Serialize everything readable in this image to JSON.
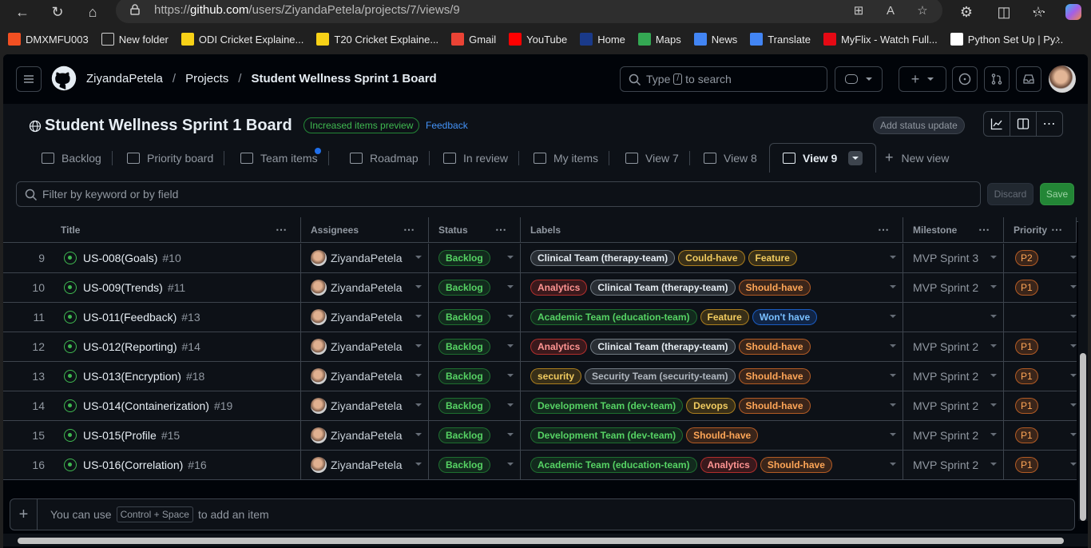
{
  "browser": {
    "url_prefix": "https://",
    "url_host": "github.com",
    "url_path": "/users/ZiyandaPetela/projects/7/views/9",
    "bookmarks": [
      {
        "label": "DMXMFU003",
        "icon": "windows-icon",
        "color": "#f25022"
      },
      {
        "label": "New folder",
        "icon": "folder-icon",
        "color": "#d0d0d0"
      },
      {
        "label": "ODI Cricket Explaine...",
        "icon": "bc-icon",
        "color": "#f7d117"
      },
      {
        "label": "T20 Cricket Explaine...",
        "icon": "bc-icon",
        "color": "#f7d117"
      },
      {
        "label": "Gmail",
        "icon": "gmail-icon",
        "color": "#ea4335"
      },
      {
        "label": "YouTube",
        "icon": "youtube-icon",
        "color": "#ff0000"
      },
      {
        "label": "Home",
        "icon": "v-icon",
        "color": "#1a3a8a"
      },
      {
        "label": "Maps",
        "icon": "maps-icon",
        "color": "#34a853"
      },
      {
        "label": "News",
        "icon": "news-icon",
        "color": "#4285f4"
      },
      {
        "label": "Translate",
        "icon": "translate-icon",
        "color": "#4285f4"
      },
      {
        "label": "MyFlix - Watch Full...",
        "icon": "m-icon",
        "color": "#e50914"
      },
      {
        "label": "Python Set Up | Py...",
        "icon": "python-icon",
        "color": "#ffffff"
      }
    ]
  },
  "header": {
    "user": "ZiyandaPetela",
    "section": "Projects",
    "board": "Student Wellness Sprint 1 Board",
    "search_prefix": "Type",
    "search_key": "/",
    "search_suffix": "to search"
  },
  "project": {
    "title": "Student Wellness Sprint 1 Board",
    "preview_badge": "Increased items preview",
    "feedback": "Feedback",
    "status_update": "Add status update"
  },
  "tabs": [
    "Backlog",
    "Priority board",
    "Team items",
    "Roadmap",
    "In review",
    "My items",
    "View 7",
    "View 8",
    "View 9"
  ],
  "new_view": "New view",
  "filter": {
    "placeholder": "Filter by keyword or by field",
    "discard": "Discard",
    "save": "Save"
  },
  "columns": [
    "Title",
    "Assignees",
    "Status",
    "Labels",
    "Milestone",
    "Priority"
  ],
  "colors": {
    "label_clinical": "#8b949e",
    "label_couldhave": "#d29922",
    "label_feature": "#d29922",
    "label_analytics": "#da3633",
    "label_shouldhave": "#db6d28",
    "label_academic": "#238636",
    "label_wonthave": "#1f6feb",
    "label_security": "#d29922",
    "label_securityteam": "#8b949e",
    "label_dev": "#238636",
    "label_devops": "#d29922",
    "status_backlog": "#238636",
    "priority": "#db6d28"
  },
  "rows": [
    {
      "num": "9",
      "title": "US-008(Goals)",
      "issue": "#10",
      "assignee": "ZiyandaPetela",
      "status": "Backlog",
      "labels": [
        {
          "text": "Clinical Team (therapy-team)",
          "kind": "clinical"
        },
        {
          "text": "Could-have",
          "kind": "couldhave"
        },
        {
          "text": "Feature",
          "kind": "feature"
        }
      ],
      "milestone": "MVP Sprint 3",
      "priority": "P2"
    },
    {
      "num": "10",
      "title": "US-009(Trends)",
      "issue": "#11",
      "assignee": "ZiyandaPetela",
      "status": "Backlog",
      "labels": [
        {
          "text": "Analytics",
          "kind": "analytics"
        },
        {
          "text": "Clinical Team (therapy-team)",
          "kind": "clinical"
        },
        {
          "text": "Should-have",
          "kind": "shouldhave"
        }
      ],
      "milestone": "MVP Sprint 2",
      "priority": "P1"
    },
    {
      "num": "11",
      "title": "US-011(Feedback)",
      "issue": "#13",
      "assignee": "ZiyandaPetela",
      "status": "Backlog",
      "labels": [
        {
          "text": "Academic Team (education-team)",
          "kind": "academic"
        },
        {
          "text": "Feature",
          "kind": "feature"
        },
        {
          "text": "Won't have",
          "kind": "wonthave"
        }
      ],
      "milestone": "",
      "priority": ""
    },
    {
      "num": "12",
      "title": "US-012(Reporting)",
      "issue": "#14",
      "assignee": "ZiyandaPetela",
      "status": "Backlog",
      "labels": [
        {
          "text": "Analytics",
          "kind": "analytics"
        },
        {
          "text": "Clinical Team (therapy-team)",
          "kind": "clinical"
        },
        {
          "text": "Should-have",
          "kind": "shouldhave"
        }
      ],
      "milestone": "MVP Sprint 2",
      "priority": "P1"
    },
    {
      "num": "13",
      "title": "US-013(Encryption)",
      "issue": "#18",
      "assignee": "ZiyandaPetela",
      "status": "Backlog",
      "labels": [
        {
          "text": "security",
          "kind": "security"
        },
        {
          "text": "Security Team (security-team)",
          "kind": "securityteam"
        },
        {
          "text": "Should-have",
          "kind": "shouldhave"
        }
      ],
      "milestone": "MVP Sprint 2",
      "priority": "P1"
    },
    {
      "num": "14",
      "title": "US-014(Containerization)",
      "issue": "#19",
      "assignee": "ZiyandaPetela",
      "status": "Backlog",
      "labels": [
        {
          "text": "Development Team (dev-team)",
          "kind": "dev"
        },
        {
          "text": "Devops",
          "kind": "devops"
        },
        {
          "text": "Should-have",
          "kind": "shouldhave"
        }
      ],
      "milestone": "MVP Sprint 2",
      "priority": "P1"
    },
    {
      "num": "15",
      "title": "US-015(Profile",
      "issue": "#15",
      "assignee": "ZiyandaPetela",
      "status": "Backlog",
      "labels": [
        {
          "text": "Development Team (dev-team)",
          "kind": "dev"
        },
        {
          "text": "Should-have",
          "kind": "shouldhave"
        }
      ],
      "milestone": "MVP Sprint 2",
      "priority": "P1"
    },
    {
      "num": "16",
      "title": "US-016(Correlation)",
      "issue": "#16",
      "assignee": "ZiyandaPetela",
      "status": "Backlog",
      "labels": [
        {
          "text": "Academic Team (education-team)",
          "kind": "academic"
        },
        {
          "text": "Analytics",
          "kind": "analytics"
        },
        {
          "text": "Should-have",
          "kind": "shouldhave"
        }
      ],
      "milestone": "MVP Sprint 2",
      "priority": "P1"
    }
  ],
  "add_item": {
    "prefix": "You can use",
    "shortcut": "Control + Space",
    "suffix": "to add an item"
  }
}
